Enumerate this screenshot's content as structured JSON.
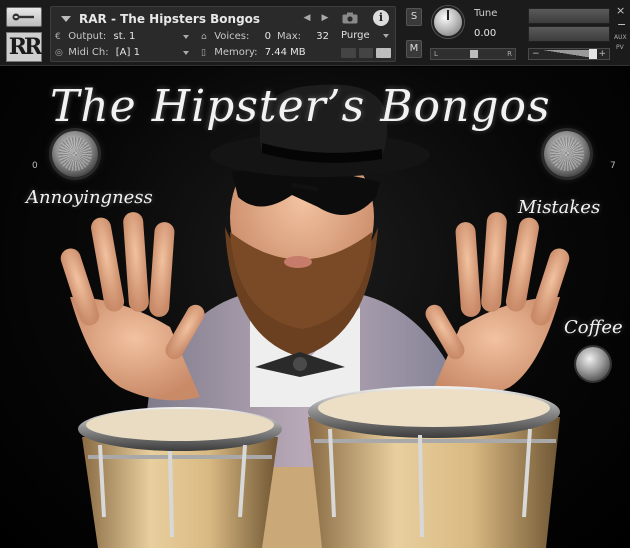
{
  "header": {
    "logo_text": "RR",
    "instrument_name": "RAR - The Hipsters Bongos",
    "output_label": "Output:",
    "output_value": "st. 1",
    "voices_label": "Voices:",
    "voices_value": "0",
    "max_label": "Max:",
    "max_value": "32",
    "purge_label": "Purge",
    "midi_label": "Midi Ch:",
    "midi_value": "[A] 1",
    "memory_label": "Memory:",
    "memory_value": "7.44 MB",
    "info_label": "i",
    "solo_label": "S",
    "mute_label": "M",
    "tune_label": "Tune",
    "tune_value": "0.00",
    "pan_left": "L",
    "pan_right": "R",
    "volume_minus": "−",
    "volume_plus": "+",
    "close_label": "×",
    "minimize_label": "−",
    "aux_label": "AUX",
    "pv_label": "PV"
  },
  "stage": {
    "title": "The Hipster’s Bongos",
    "knob_left_label": "Annoyingness",
    "knob_left_min": "0",
    "knob_right_label": "Mistakes",
    "knob_right_max": "7",
    "button_label": "Coffee"
  },
  "colors": {
    "header_bg": "#1b1b1b",
    "panel_bg": "#2a2a2a",
    "stage_bg": "#000000",
    "script_text": "#f2f2f2"
  }
}
